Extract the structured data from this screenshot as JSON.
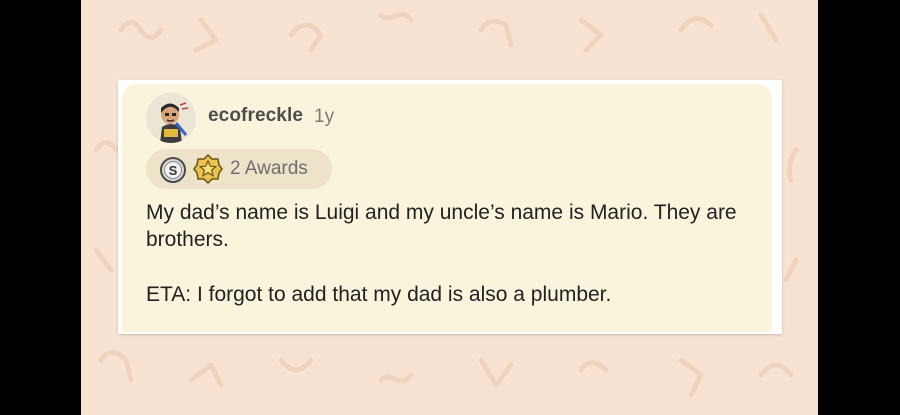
{
  "comment": {
    "username": "ecofreckle",
    "age": "1y",
    "awards_label": "2 Awards",
    "paragraphs": [
      "My dad’s name is Luigi and my uncle’s name is Mario. They are brothers.",
      "ETA: I forgot to add that my dad is also a plumber."
    ],
    "awards": [
      "silver-award-icon",
      "gold-star-award-icon"
    ]
  },
  "colors": {
    "background": "#f8e3d2",
    "card": "#fbf4dd",
    "pill": "#ece3c9",
    "text": "#222222"
  }
}
